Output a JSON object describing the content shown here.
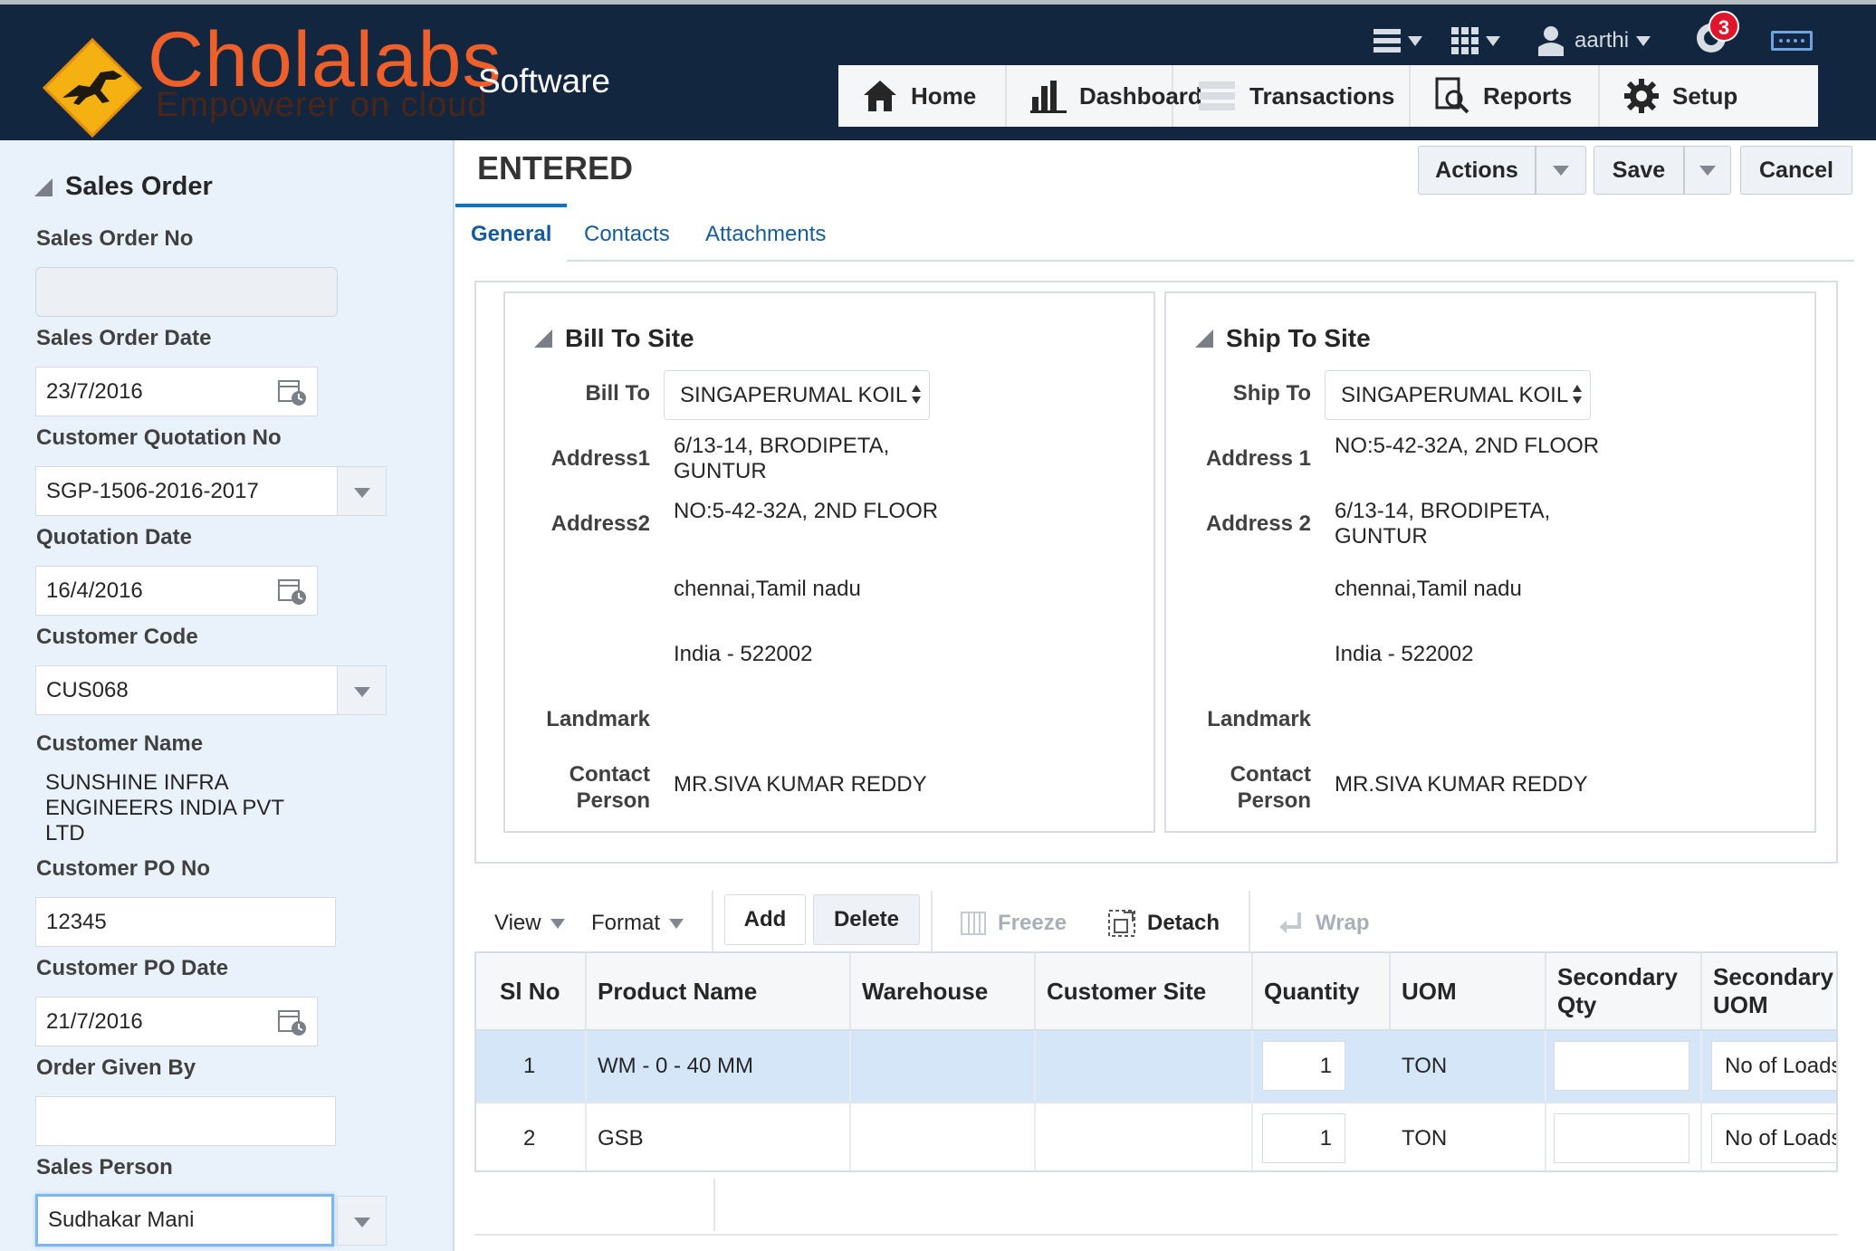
{
  "brand": {
    "name": "Cholalabs",
    "tagline": "Empowerer on cloud",
    "product": "Software"
  },
  "user": {
    "name": "aarthi",
    "notifications": "3"
  },
  "nav": [
    {
      "label": "Home",
      "icon": "home-icon"
    },
    {
      "label": "Dashboard",
      "icon": "bar-chart-icon"
    },
    {
      "label": "Transactions",
      "icon": "transactions-icon"
    },
    {
      "label": "Reports",
      "icon": "reports-icon"
    },
    {
      "label": "Setup",
      "icon": "gear-icon"
    }
  ],
  "sidebar": {
    "title": "Sales Order",
    "sales_order_no_label": "Sales Order No",
    "sales_order_no": "",
    "sales_order_date_label": "Sales Order Date",
    "sales_order_date": "23/7/2016",
    "customer_quotation_no_label": "Customer Quotation No",
    "customer_quotation_no": "SGP-1506-2016-2017",
    "quotation_date_label": "Quotation Date",
    "quotation_date": "16/4/2016",
    "customer_code_label": "Customer Code",
    "customer_code": "CUS068",
    "customer_name_label": "Customer Name",
    "customer_name": "SUNSHINE INFRA ENGINEERS INDIA PVT LTD",
    "customer_po_no_label": "Customer PO No",
    "customer_po_no": "12345",
    "customer_po_date_label": "Customer PO Date",
    "customer_po_date": "21/7/2016",
    "order_given_by_label": "Order Given By",
    "order_given_by": "",
    "sales_person_label": "Sales Person",
    "sales_person": "Sudhakar Mani"
  },
  "page": {
    "status": "ENTERED",
    "actions_label": "Actions",
    "save_label": "Save",
    "cancel_label": "Cancel"
  },
  "tabs": [
    "General",
    "Contacts",
    "Attachments"
  ],
  "bill_to": {
    "title": "Bill To Site",
    "site_label": "Bill To",
    "site": "SINGAPERUMAL KOIL",
    "address1_label": "Address1",
    "address1": "6/13-14, BRODIPETA, GUNTUR",
    "address2_label": "Address2",
    "address2": "NO:5-42-32A, 2ND FLOOR",
    "city_state": "chennai,Tamil nadu",
    "country_pin": "India - 522002",
    "landmark_label": "Landmark",
    "landmark": "",
    "contact_label": "Contact Person",
    "contact": "MR.SIVA KUMAR REDDY"
  },
  "ship_to": {
    "title": "Ship To Site",
    "site_label": "Ship To",
    "site": "SINGAPERUMAL KOIL",
    "address1_label": "Address 1",
    "address1": "NO:5-42-32A, 2ND FLOOR",
    "address2_label": "Address 2",
    "address2": "6/13-14, BRODIPETA, GUNTUR",
    "city_state": "chennai,Tamil nadu",
    "country_pin": "India - 522002",
    "landmark_label": "Landmark",
    "landmark": "",
    "contact_label": "Contact Person",
    "contact": "MR.SIVA KUMAR REDDY"
  },
  "toolbar": {
    "view": "View",
    "format": "Format",
    "add": "Add",
    "delete": "Delete",
    "freeze": "Freeze",
    "detach": "Detach",
    "wrap": "Wrap"
  },
  "table": {
    "columns": [
      "Sl No",
      "Product Name",
      "Warehouse",
      "Customer Site",
      "Quantity",
      "UOM",
      "Secondary Qty",
      "Secondary UOM"
    ],
    "rows": [
      {
        "sl": "1",
        "product": "WM - 0 - 40 MM",
        "warehouse": "",
        "site": "",
        "qty": "1",
        "uom": "TON",
        "sec_qty": "",
        "sec_uom": "No of Loads"
      },
      {
        "sl": "2",
        "product": "GSB",
        "warehouse": "",
        "site": "",
        "qty": "1",
        "uom": "TON",
        "sec_qty": "",
        "sec_uom": "No of Loads"
      }
    ]
  },
  "colors": {
    "header_bg": "#13263f",
    "brand": "#ee5f2a",
    "accent": "#0572ce",
    "sidebar_bg": "#e9f2fb",
    "selected_row": "#d4e6f8"
  }
}
